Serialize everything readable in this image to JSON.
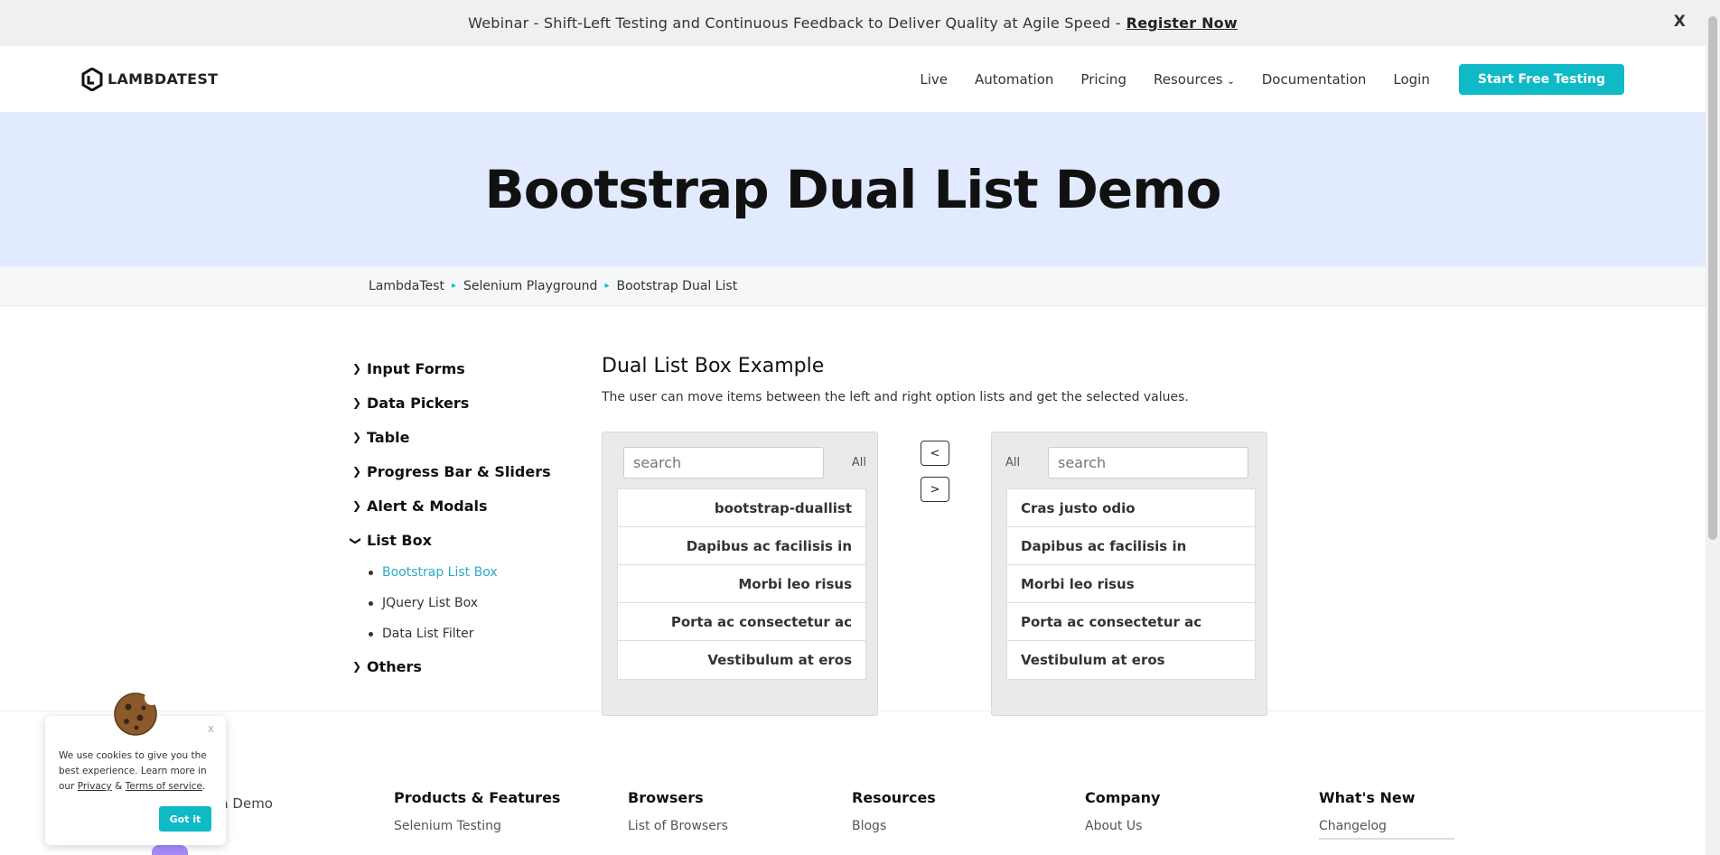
{
  "banner": {
    "text": "Webinar - Shift-Left Testing and Continuous Feedback to Deliver Quality at Agile Speed -",
    "link": "Register Now",
    "close": "X"
  },
  "nav": {
    "logo": "LAMBDATEST",
    "links": [
      "Live",
      "Automation",
      "Pricing",
      "Resources",
      "Documentation",
      "Login"
    ],
    "cta": "Start Free Testing"
  },
  "hero": {
    "title": "Bootstrap Dual List Demo"
  },
  "breadcrumb": [
    "LambdaTest",
    "Selenium Playground",
    "Bootstrap Dual List"
  ],
  "sidebar": {
    "items": [
      "Input Forms",
      "Data Pickers",
      "Table",
      "Progress Bar & Sliders",
      "Alert & Modals",
      "List Box",
      "Others"
    ],
    "list_box_sub": [
      "Bootstrap List Box",
      "JQuery List Box",
      "Data List Filter"
    ]
  },
  "main": {
    "title": "Dual List Box Example",
    "desc": "The user can move items between the left and right option lists and get the selected values.",
    "left": {
      "placeholder": "search",
      "all": "All",
      "items": [
        "bootstrap-duallist",
        "Dapibus ac facilisis in",
        "Morbi leo risus",
        "Porta ac consectetur ac",
        "Vestibulum at eros"
      ]
    },
    "right": {
      "placeholder": "search",
      "all": "All",
      "items": [
        "Cras justo odio",
        "Dapibus ac facilisis in",
        "Morbi leo risus",
        "Porta ac consectetur ac",
        "Vestibulum at eros"
      ]
    },
    "move_left": "<",
    "move_right": ">"
  },
  "footer": {
    "book": "k a Demo",
    "columns": [
      {
        "head": "Products & Features",
        "link": "Selenium Testing"
      },
      {
        "head": "Browsers",
        "link": "List of Browsers"
      },
      {
        "head": "Resources",
        "link": "Blogs"
      },
      {
        "head": "Company",
        "link": "About Us"
      },
      {
        "head": "What's New",
        "link": "Changelog"
      }
    ]
  },
  "cookie": {
    "text_1": "We use cookies to give you the best experience. Learn more in our",
    "privacy": "Privacy",
    "amp": "&",
    "terms": "Terms of service",
    "dot": ".",
    "button": "Got it",
    "close": "x"
  },
  "colors": {
    "accent": "#0ebac5",
    "hero_bg": "#e1eafe",
    "active_link": "#2fa8c7"
  }
}
